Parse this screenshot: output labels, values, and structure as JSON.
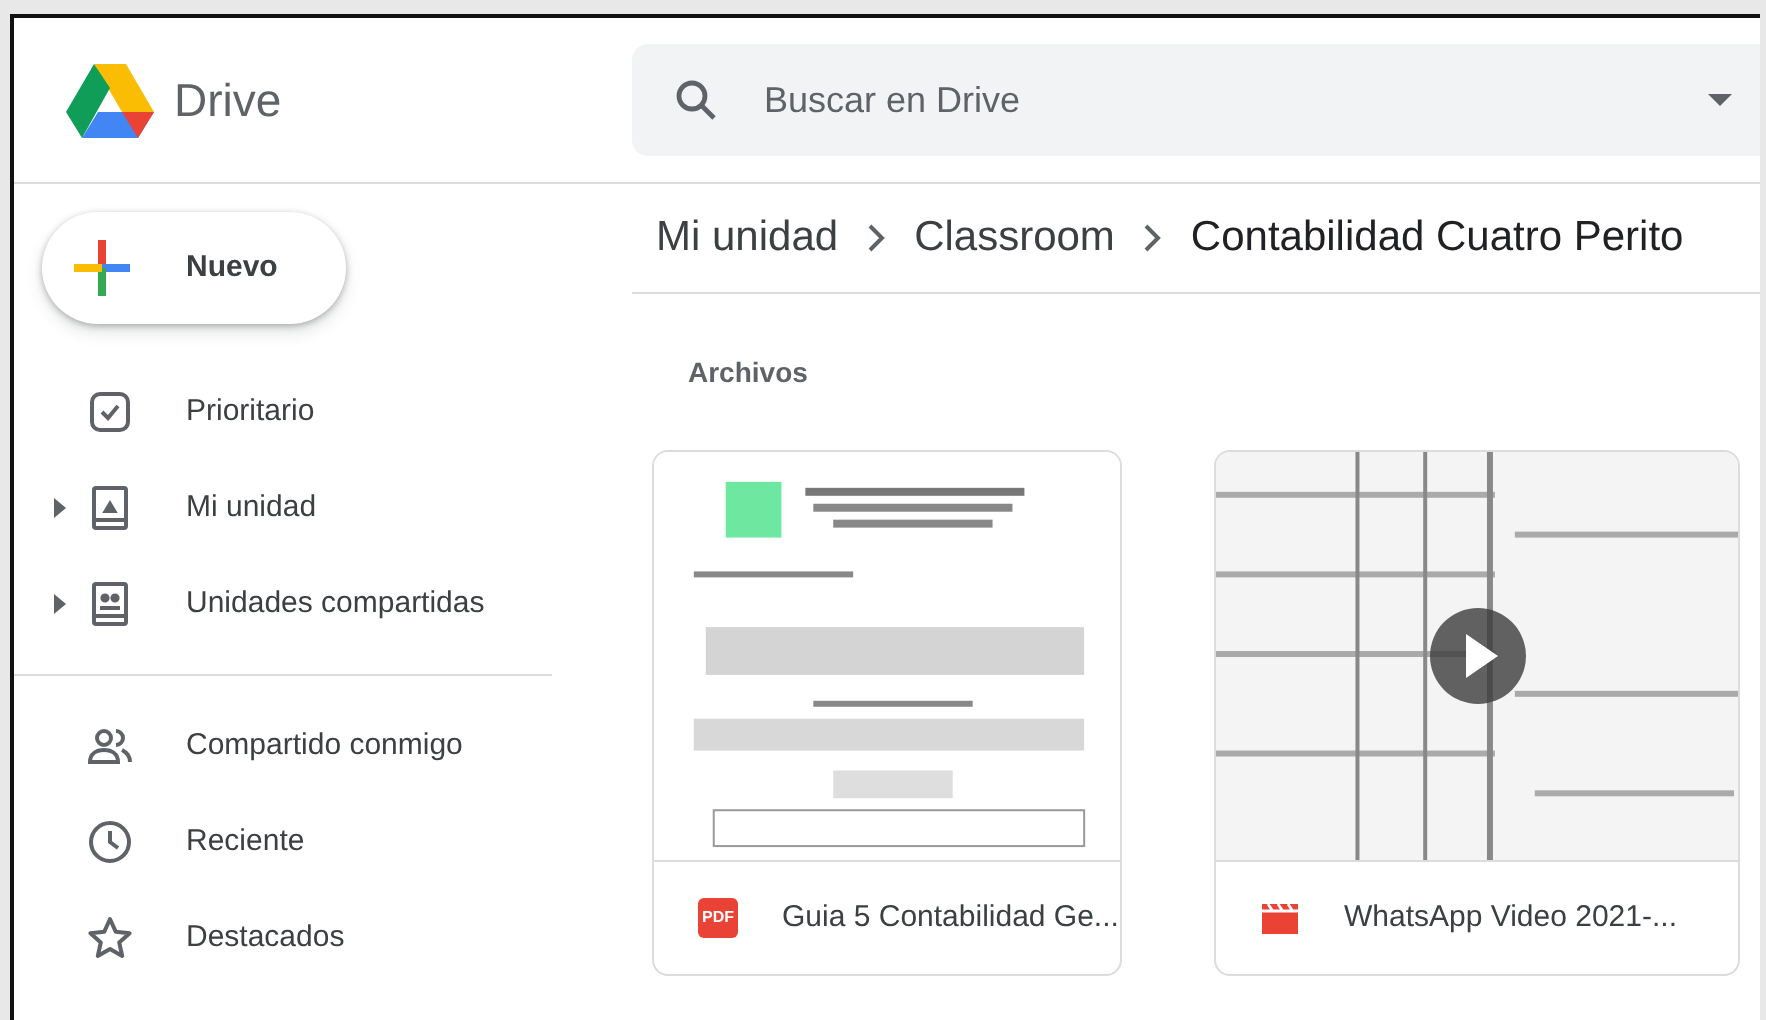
{
  "app": {
    "name": "Drive"
  },
  "search": {
    "placeholder": "Buscar en Drive"
  },
  "new_button": {
    "label": "Nuevo"
  },
  "sidebar": {
    "items": [
      {
        "label": "Prioritario",
        "kind": "priority",
        "expandable": false
      },
      {
        "label": "Mi unidad",
        "kind": "drive",
        "expandable": true
      },
      {
        "label": "Unidades compartidas",
        "kind": "shared-drives",
        "expandable": true
      },
      {
        "label": "Compartido conmigo",
        "kind": "shared",
        "expandable": false,
        "divider_before": true
      },
      {
        "label": "Reciente",
        "kind": "recent",
        "expandable": false
      },
      {
        "label": "Destacados",
        "kind": "starred",
        "expandable": false
      }
    ]
  },
  "breadcrumb": [
    "Mi unidad",
    "Classroom",
    "Contabilidad Cuatro Perito"
  ],
  "section_title": "Archivos",
  "files": [
    {
      "name": "Guia 5 Contabilidad Ge...",
      "kind": "pdf",
      "type_label": "PDF"
    },
    {
      "name": "WhatsApp Video 2021-...",
      "kind": "video"
    }
  ]
}
